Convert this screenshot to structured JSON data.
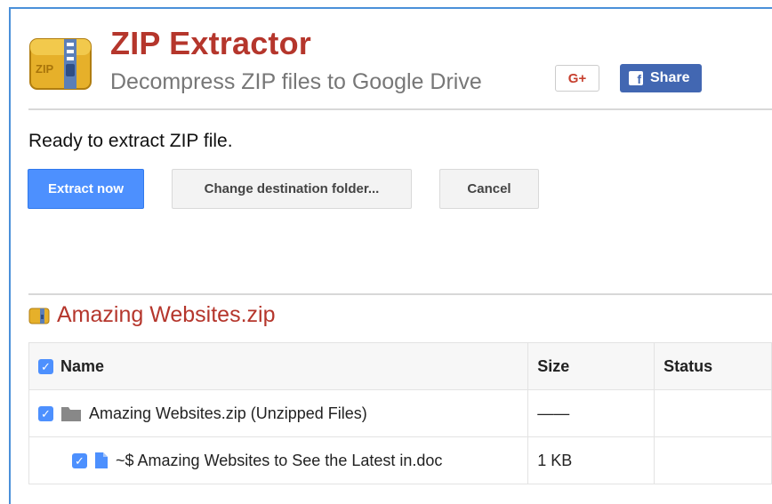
{
  "app": {
    "title": "ZIP Extractor",
    "subtitle": "Decompress ZIP files to Google Drive",
    "logo_text": "ZIP"
  },
  "social": {
    "gplus_label": "G+",
    "share_label": "Share"
  },
  "status": {
    "message": "Ready to extract ZIP file."
  },
  "actions": {
    "extract_label": "Extract now",
    "change_label": "Change destination folder...",
    "cancel_label": "Cancel"
  },
  "archive": {
    "name": "Amazing Websites.zip"
  },
  "table": {
    "headers": {
      "name": "Name",
      "size": "Size",
      "status": "Status"
    },
    "rows": [
      {
        "name": "Amazing Websites.zip (Unzipped Files)",
        "size": "——",
        "status": "",
        "type": "folder",
        "checked": true
      },
      {
        "name": "~$ Amazing Websites to See the Latest in.doc",
        "size": "1 KB",
        "status": "",
        "type": "file",
        "checked": true
      }
    ]
  },
  "colors": {
    "brand_red": "#b5362c",
    "accent_blue": "#4d90fe",
    "facebook_blue": "#4267b2"
  }
}
